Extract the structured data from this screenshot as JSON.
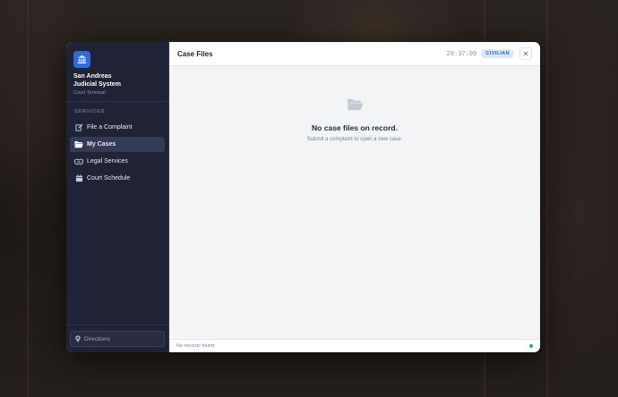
{
  "sidebar": {
    "brand": {
      "icon": "courthouse-icon",
      "title_line1": "San Andreas",
      "title_line2": "Judicial System",
      "subtitle": "Court Terminal"
    },
    "section_label": "SERVICES",
    "items": [
      {
        "label": "File a Complaint",
        "icon": "edit-icon",
        "active": false
      },
      {
        "label": "My Cases",
        "icon": "folder-open-icon",
        "active": true
      },
      {
        "label": "Legal Services",
        "icon": "handshake-icon",
        "active": false
      },
      {
        "label": "Court Schedule",
        "icon": "calendar-icon",
        "active": false
      }
    ],
    "footer": {
      "directions_label": "Directions",
      "icon": "map-pin-icon"
    }
  },
  "header": {
    "title": "Case Files",
    "clock": "20:37:09",
    "role_badge": "CIVILIAN",
    "close_label": "✕"
  },
  "main": {
    "empty_state": {
      "icon": "folder-open-icon",
      "title": "No case files on record.",
      "subtitle": "Submit a complaint to open a new case."
    }
  },
  "statusbar": {
    "text": "No records found.",
    "indicator_color": "#22b04b"
  },
  "colors": {
    "accent": "#2f6be3",
    "sidebar_bg": "#1e2436",
    "active_item_bg": "#323c56",
    "badge_bg": "#dbe7fd",
    "badge_text": "#2e5fc4"
  }
}
